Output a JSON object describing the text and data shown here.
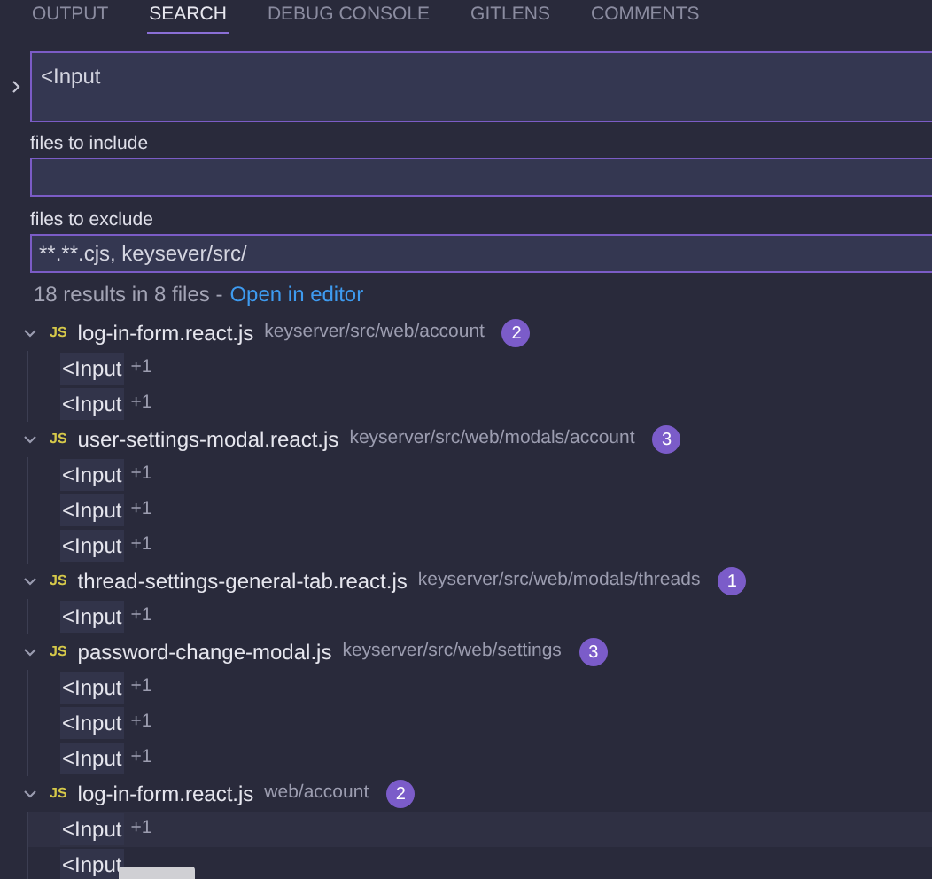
{
  "tabs": [
    {
      "label": "OUTPUT",
      "selected": false
    },
    {
      "label": "SEARCH",
      "selected": true
    },
    {
      "label": "DEBUG CONSOLE",
      "selected": false
    },
    {
      "label": "GITLENS",
      "selected": false
    },
    {
      "label": "COMMENTS",
      "selected": false
    }
  ],
  "search": {
    "value": "<Input",
    "expanded": false
  },
  "include": {
    "label": "files to include"
  },
  "exclude": {
    "label": "files to exclude",
    "value": "**.**.cjs, keysever/src/"
  },
  "summary": {
    "text": "18 results in 8 files -",
    "link": "Open in editor"
  },
  "files": [
    {
      "icon": "JS",
      "name": "log-in-form.react.js",
      "path": "keyserver/src/web/account",
      "count": "2",
      "expanded": true,
      "matches": [
        {
          "text": "<Input",
          "count": "+1",
          "hovered": false
        },
        {
          "text": "<Input",
          "count": "+1",
          "hovered": false
        }
      ]
    },
    {
      "icon": "JS",
      "name": "user-settings-modal.react.js",
      "path": "keyserver/src/web/modals/account",
      "count": "3",
      "expanded": true,
      "matches": [
        {
          "text": "<Input",
          "count": "+1",
          "hovered": false
        },
        {
          "text": "<Input",
          "count": "+1",
          "hovered": false
        },
        {
          "text": "<Input",
          "count": "+1",
          "hovered": false
        }
      ]
    },
    {
      "icon": "JS",
      "name": "thread-settings-general-tab.react.js",
      "path": "keyserver/src/web/modals/threads",
      "count": "1",
      "expanded": true,
      "matches": [
        {
          "text": "<Input",
          "count": "+1",
          "hovered": false
        }
      ]
    },
    {
      "icon": "JS",
      "name": "password-change-modal.js",
      "path": "keyserver/src/web/settings",
      "count": "3",
      "expanded": true,
      "matches": [
        {
          "text": "<Input",
          "count": "+1",
          "hovered": false
        },
        {
          "text": "<Input",
          "count": "+1",
          "hovered": false
        },
        {
          "text": "<Input",
          "count": "+1",
          "hovered": false
        }
      ]
    },
    {
      "icon": "JS",
      "name": "log-in-form.react.js",
      "path": "web/account",
      "count": "2",
      "expanded": true,
      "matches": [
        {
          "text": "<Input",
          "count": "+1",
          "hovered": true
        },
        {
          "text": "<Input",
          "hovered": false
        }
      ]
    }
  ]
}
